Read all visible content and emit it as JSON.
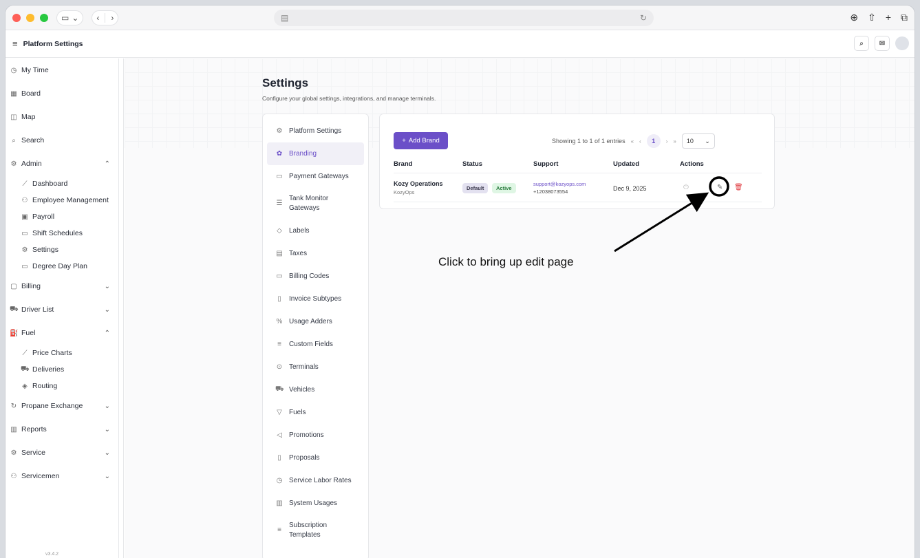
{
  "browser": {
    "address": ""
  },
  "app": {
    "title": "Platform Settings",
    "version": "v3.4.2"
  },
  "sidebar": {
    "items": [
      {
        "label": "My Time",
        "icon": "clock-icon"
      },
      {
        "label": "Board",
        "icon": "board-icon"
      },
      {
        "label": "Map",
        "icon": "map-icon"
      },
      {
        "label": "Search",
        "icon": "search-icon"
      },
      {
        "label": "Admin",
        "icon": "gear-icon",
        "expanded": true
      },
      {
        "label": "Billing",
        "icon": "billing-icon"
      },
      {
        "label": "Driver List",
        "icon": "truck-icon"
      },
      {
        "label": "Fuel",
        "icon": "fuel-icon",
        "expanded": true
      },
      {
        "label": "Propane Exchange",
        "icon": "refresh-icon"
      },
      {
        "label": "Reports",
        "icon": "chart-icon"
      },
      {
        "label": "Service",
        "icon": "gear-icon"
      },
      {
        "label": "Servicemen",
        "icon": "users-icon"
      }
    ],
    "admin_sub": [
      {
        "label": "Dashboard"
      },
      {
        "label": "Employee Management"
      },
      {
        "label": "Payroll"
      },
      {
        "label": "Shift Schedules"
      },
      {
        "label": "Settings"
      },
      {
        "label": "Degree Day Plan"
      }
    ],
    "fuel_sub": [
      {
        "label": "Price Charts"
      },
      {
        "label": "Deliveries"
      },
      {
        "label": "Routing"
      }
    ]
  },
  "page": {
    "title": "Settings",
    "subtitle": "Configure your global settings, integrations, and manage terminals."
  },
  "settings_menu": [
    {
      "label": "Platform Settings"
    },
    {
      "label": "Branding",
      "active": true
    },
    {
      "label": "Payment Gateways"
    },
    {
      "label": "Tank Monitor Gateways"
    },
    {
      "label": "Labels"
    },
    {
      "label": "Taxes"
    },
    {
      "label": "Billing Codes"
    },
    {
      "label": "Invoice Subtypes"
    },
    {
      "label": "Usage Adders"
    },
    {
      "label": "Custom Fields"
    },
    {
      "label": "Terminals"
    },
    {
      "label": "Vehicles"
    },
    {
      "label": "Fuels"
    },
    {
      "label": "Promotions"
    },
    {
      "label": "Proposals"
    },
    {
      "label": "Service Labor Rates"
    },
    {
      "label": "System Usages"
    },
    {
      "label": "Subscription Templates"
    }
  ],
  "table": {
    "add_label": "Add Brand",
    "showing": "Showing 1 to 1 of 1 entries",
    "current_page": "1",
    "page_size": "10",
    "columns": [
      "Brand",
      "Status",
      "Support",
      "Updated",
      "Actions"
    ],
    "rows": [
      {
        "brand": "Kozy Operations",
        "brand_sub": "KozyOps",
        "badges": [
          "Default",
          "Active"
        ],
        "support_email": "support@kozyops.com",
        "support_phone": "+12038073554",
        "updated": "Dec 9, 2025"
      }
    ]
  },
  "annotation": {
    "text": "Click to bring up edit page"
  },
  "colors": {
    "accent": "#6b4fc8",
    "delete": "#e0393e"
  }
}
